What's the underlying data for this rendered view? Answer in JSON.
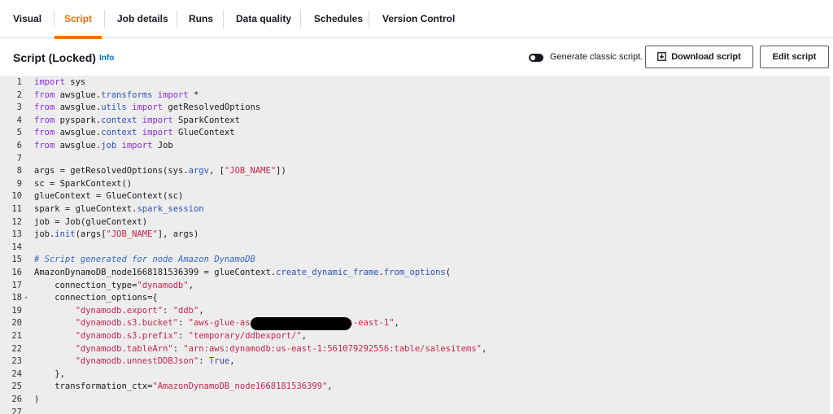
{
  "tabs": [
    "Visual",
    "Script",
    "Job details",
    "Runs",
    "Data quality",
    "Schedules",
    "Version Control"
  ],
  "active_tab": "Script",
  "header": {
    "title": "Script (Locked)",
    "info": "Info",
    "toggle_label": "Generate classic script.",
    "download_label": "Download script",
    "edit_label": "Edit script"
  },
  "code_lines": [
    "import sys",
    "from awsglue.transforms import *",
    "from awsglue.utils import getResolvedOptions",
    "from pyspark.context import SparkContext",
    "from awsglue.context import GlueContext",
    "from awsglue.job import Job",
    "",
    "args = getResolvedOptions(sys.argv, [\"JOB_NAME\"])",
    "sc = SparkContext()",
    "glueContext = GlueContext(sc)",
    "spark = glueContext.spark_session",
    "job = Job(glueContext)",
    "job.init(args[\"JOB_NAME\"], args)",
    "",
    "# Script generated for node Amazon DynamoDB",
    "AmazonDynamoDB_node1668181536399 = glueContext.create_dynamic_frame.from_options(",
    "    connection_type=\"dynamodb\",",
    "    connection_options={",
    "        \"dynamodb.export\": \"ddb\",",
    "        \"dynamodb.s3.bucket\": \"aws-glue-assets-            -us-east-1\",",
    "        \"dynamodb.s3.prefix\": \"temporary/ddbexport/\",",
    "        \"dynamodb.tableArn\": \"arn:aws:dynamodb:us-east-1:561079292556:table/salesitems\",",
    "        \"dynamodb.unnestDDBJson\": True,",
    "    },",
    "    transformation_ctx=\"AmazonDynamoDB_node1668181536399\",",
    ")",
    ""
  ],
  "line_numbers": [
    "1",
    "2",
    "3",
    "4",
    "5",
    "6",
    "7",
    "8",
    "9",
    "10",
    "11",
    "12",
    "13",
    "14",
    "15",
    "16",
    "17",
    "18",
    "19",
    "20",
    "21",
    "22",
    "23",
    "24",
    "25",
    "26",
    "27"
  ],
  "fold_markers": {
    "18": "▾"
  }
}
